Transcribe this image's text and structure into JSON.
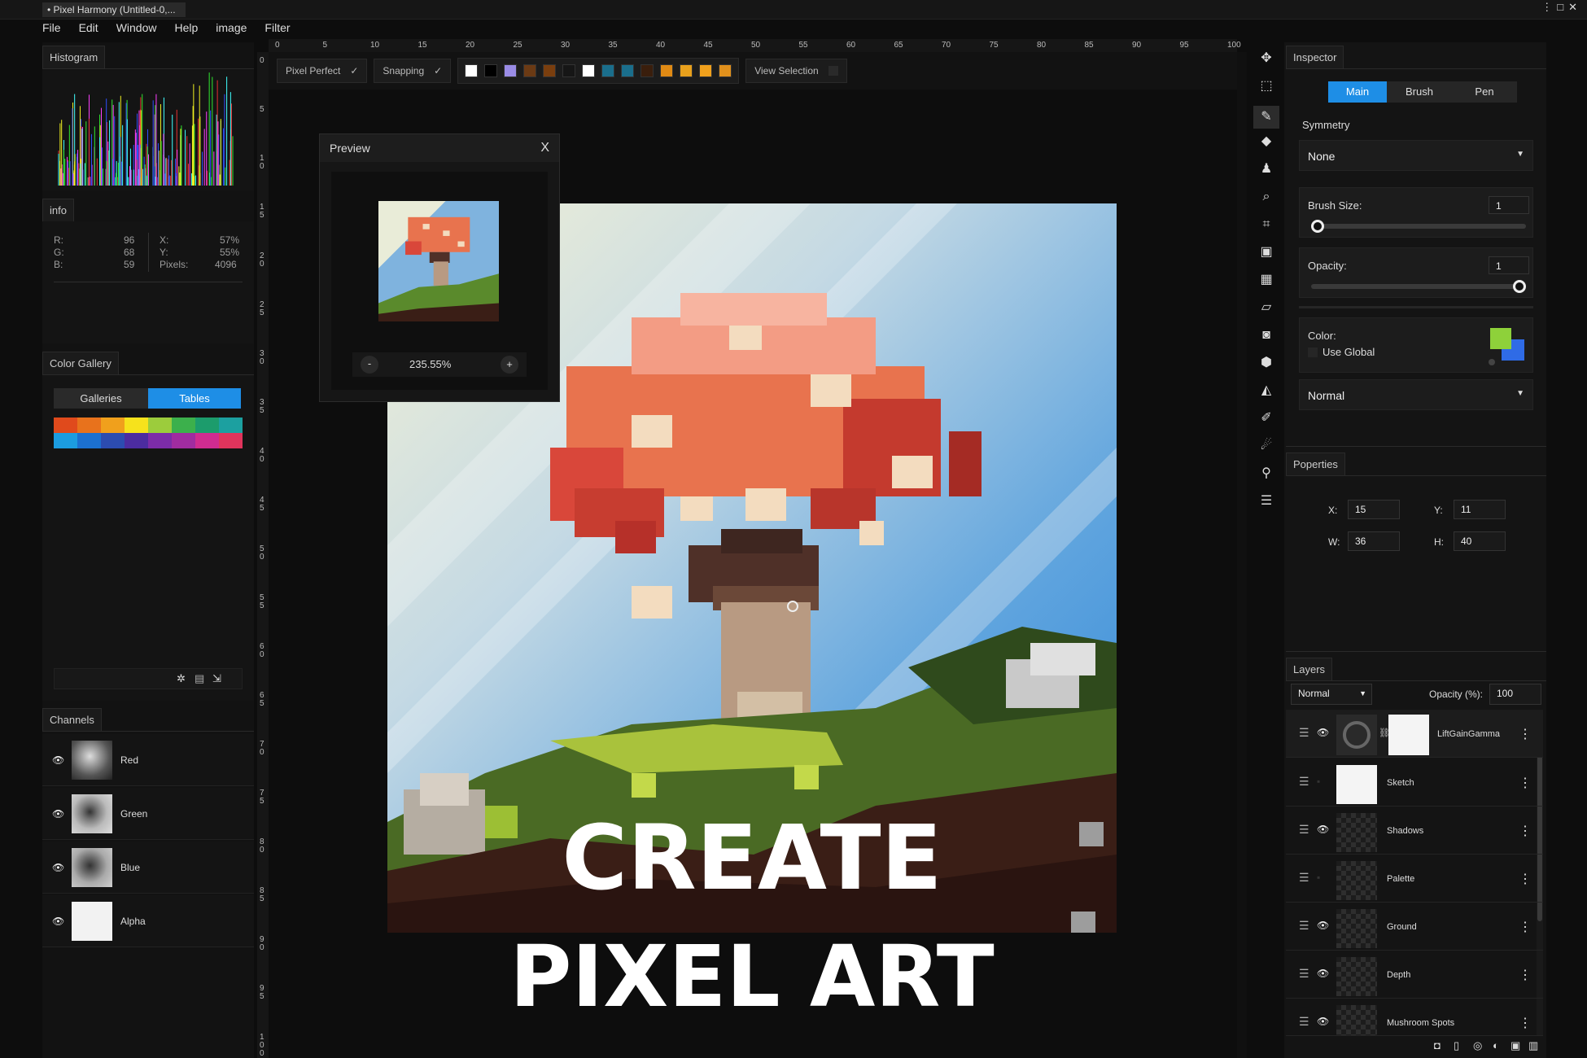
{
  "window": {
    "title": "• Pixel Harmony (Untitled-0,...",
    "controls": [
      "⋮",
      "□",
      "✕"
    ]
  },
  "menu": [
    "File",
    "Edit",
    "Window",
    "Help",
    "image",
    "Filter"
  ],
  "panels": {
    "histogram": {
      "title": "Histogram"
    },
    "info": {
      "title": "info",
      "r_label": "R:",
      "r_value": "96",
      "g_label": "G:",
      "g_value": "68",
      "b_label": "B:",
      "b_value": "59",
      "x_label": "X:",
      "x_value": "57%",
      "y_label": "Y:",
      "y_value": "55%",
      "pixels_label": "Pixels:",
      "pixels_value": "4096"
    },
    "color_gallery": {
      "title": "Color Gallery",
      "tab_galleries": "Galleries",
      "tab_tables": "Tables",
      "swatches_row1": [
        "#e04a1c",
        "#e8721c",
        "#f0a01c",
        "#f6e21c",
        "#9ccc3c",
        "#3cb04c",
        "#1c9c6c",
        "#1ca0a0"
      ],
      "swatches_row2": [
        "#1c9ce0",
        "#1c70d0",
        "#2c4cb0",
        "#4c2ca0",
        "#7c2ca8",
        "#a02ca0",
        "#d02c90",
        "#e0345c"
      ]
    },
    "channels": {
      "title": "Channels",
      "items": [
        "Red",
        "Green",
        "Blue",
        "Alpha"
      ]
    }
  },
  "ruler": {
    "top": [
      "0",
      "5",
      "10",
      "15",
      "20",
      "25",
      "30",
      "35",
      "40",
      "45",
      "50",
      "55",
      "60",
      "65",
      "70",
      "75",
      "80",
      "85",
      "90",
      "95",
      "100"
    ],
    "left": [
      "0",
      "5",
      "1 0",
      "1 5",
      "2 0",
      "2 5",
      "3 0",
      "3 5",
      "4 0",
      "4 5",
      "5 0",
      "5 5",
      "6 0",
      "6 5",
      "7 0",
      "7 5",
      "8 0",
      "8 5",
      "9 0",
      "9 5",
      "1 0 0"
    ]
  },
  "options_bar": {
    "pixel_perfect": "Pixel Perfect",
    "snapping": "Snapping",
    "view_selection": "View Selection",
    "check": "✓",
    "swatches": [
      "#ffffff",
      "#000000",
      "#9a8ce6",
      "#6b3a14",
      "#7a3e0e",
      "#161616",
      "#ffffff",
      "#1a6e8c",
      "#1a6e8c",
      "#3a1e0c",
      "#e08a14",
      "#e8a01c",
      "#f0a01c",
      "#e0901c"
    ]
  },
  "preview": {
    "title": "Preview",
    "close": "X",
    "zoom_minus": "-",
    "zoom_value": "235.55%",
    "zoom_plus": "+"
  },
  "overlay": {
    "line1": "CREATE",
    "line2": "PIXEL ART"
  },
  "inspector": {
    "title": "Inspector",
    "tabs": [
      "Main",
      "Brush",
      "Pen"
    ],
    "symmetry_label": "Symmetry",
    "symmetry_value": "None",
    "brush_size_label": "Brush Size:",
    "brush_size_value": "1",
    "brush_size_slider": 0.0,
    "opacity_label": "Opacity:",
    "opacity_value": "1",
    "opacity_slider": 1.0,
    "color_label": "Color:",
    "use_global": "Use Global",
    "primary_color": "#8ed13a",
    "secondary_color": "#2f6be6",
    "blend_value": "Normal"
  },
  "properties": {
    "title": "Poperties",
    "x_label": "X:",
    "x_value": "15",
    "y_label": "Y:",
    "y_value": "11",
    "w_label": "W:",
    "w_value": "36",
    "h_label": "H:",
    "h_value": "40"
  },
  "layers": {
    "title": "Layers",
    "blend": "Normal",
    "opacity_label": "Opacity (%):",
    "opacity_value": "100",
    "items": [
      "LiftGainGamma",
      "Sketch",
      "Shadows",
      "Palette",
      "Ground",
      "Depth",
      "Mushroom Spots"
    ]
  }
}
